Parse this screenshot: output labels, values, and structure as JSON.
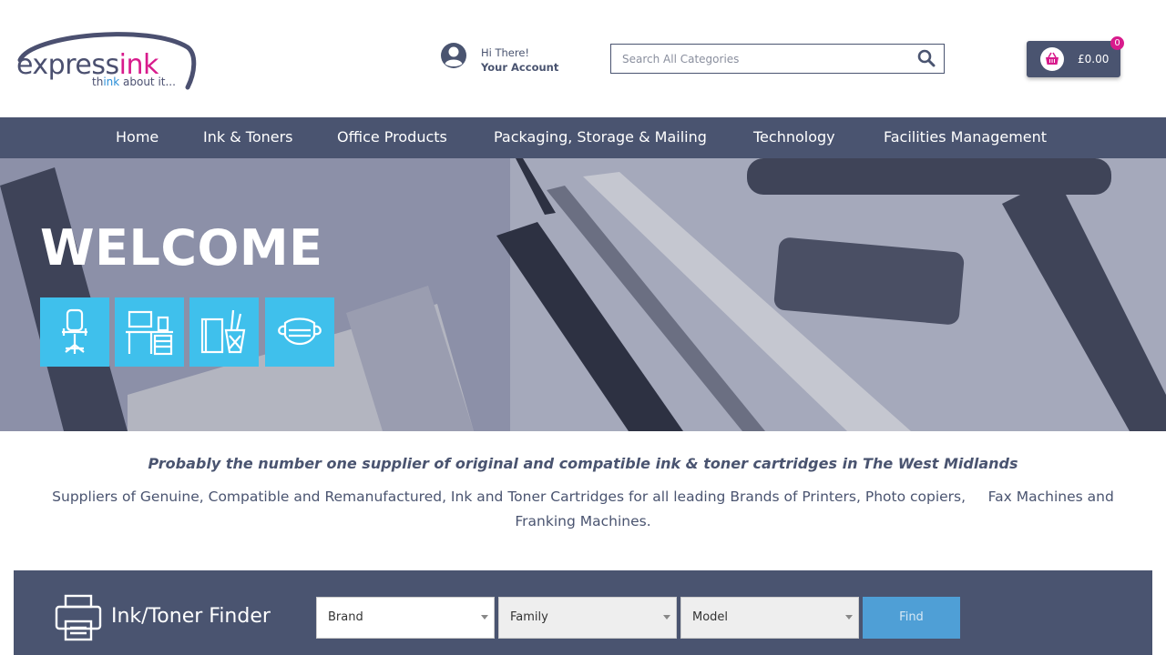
{
  "header": {
    "logo": {
      "express": "express",
      "ink": "ink",
      "tag_think": "th",
      "tag_ink": "ink",
      "tag_rest": " about it..."
    },
    "account": {
      "greeting": "Hi There!",
      "label": "Your Account"
    },
    "search": {
      "placeholder": "Search All Categories"
    },
    "cart": {
      "total": "£0.00",
      "count": "0"
    }
  },
  "nav": {
    "items": [
      {
        "label": "Home"
      },
      {
        "label": "Ink & Toners"
      },
      {
        "label": "Office Products"
      },
      {
        "label": "Packaging, Storage & Mailing"
      },
      {
        "label": "Technology"
      },
      {
        "label": "Facilities Management"
      }
    ]
  },
  "hero": {
    "title": "WELCOME",
    "categories": [
      {
        "icon": "office-chair-icon"
      },
      {
        "icon": "desk-furniture-icon"
      },
      {
        "icon": "stationery-icon"
      },
      {
        "icon": "face-mask-icon"
      }
    ]
  },
  "intro": {
    "tagline": "Probably the number one supplier of original and compatible ink & toner cartridges in The West Midlands",
    "text": "Suppliers of Genuine, Compatible and Remanufactured, Ink and Toner Cartridges for all leading Brands of Printers, Photo copiers,     Fax Machines and Franking Machines."
  },
  "finder": {
    "title": "Ink/Toner Finder",
    "brand": "Brand",
    "family": "Family",
    "model": "Model",
    "find": "Find"
  },
  "colors": {
    "nav_bg": "#4a5470",
    "accent_pink": "#d81b8c",
    "tile_blue": "#3fc0ec",
    "find_blue": "#4f9fd6"
  }
}
